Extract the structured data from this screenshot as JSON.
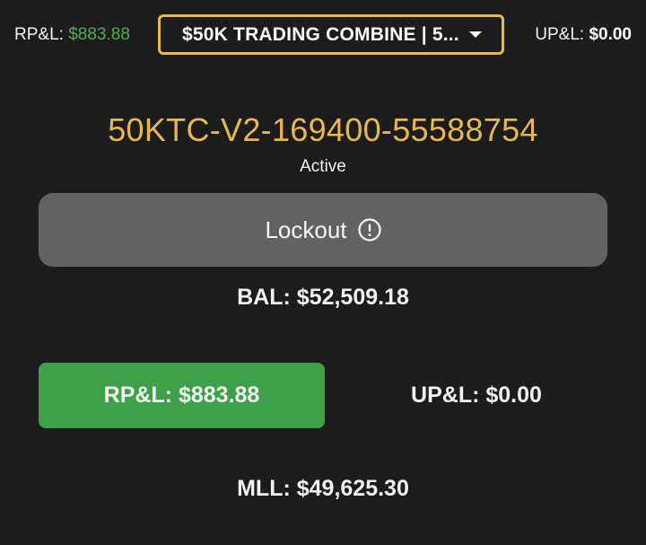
{
  "header": {
    "rpl_label": "RP&L:",
    "rpl_value": "$883.88",
    "upl_label": "UP&L:",
    "upl_value": "$0.00",
    "account_select": {
      "selected": "$50K TRADING COMBINE  |  5...",
      "icon": "chevron-down-icon"
    }
  },
  "account": {
    "id": "50KTC-V2-169400-55588754",
    "status": "Active"
  },
  "lockout": {
    "label": "Lockout",
    "icon": "alert-circle-icon"
  },
  "balance": {
    "text": "BAL: $52,509.18"
  },
  "pnl": {
    "rpl_button": "RP&L: $883.88",
    "upl_text": "UP&L: $0.00"
  },
  "mll": {
    "text": "MLL: $49,625.30"
  },
  "colors": {
    "background": "#1c1c1e",
    "accent_gold": "#e8b84b",
    "profit_green": "#4caf50",
    "button_green": "#3fa04a",
    "lockout_gray": "#626262"
  }
}
